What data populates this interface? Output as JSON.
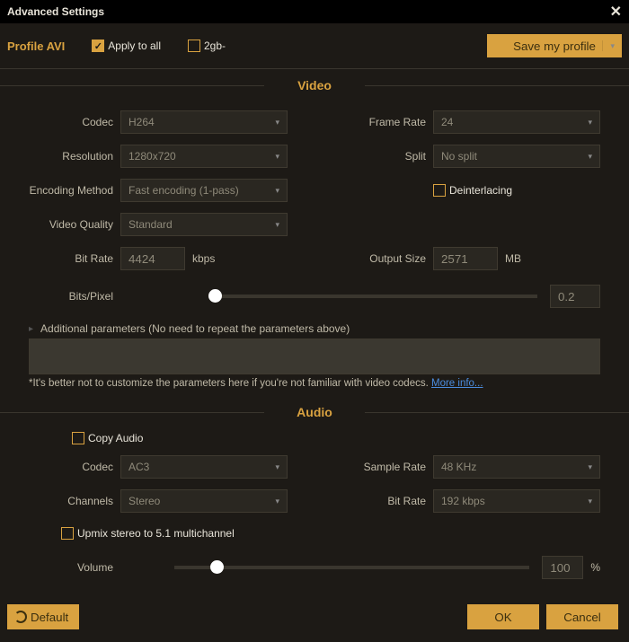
{
  "title": "Advanced Settings",
  "header": {
    "profile_label": "Profile AVI",
    "apply_all_label": "Apply to all",
    "two_gb_label": "2gb-",
    "save_profile_label": "Save my profile"
  },
  "sections": {
    "video": "Video",
    "audio": "Audio"
  },
  "video": {
    "codec_label": "Codec",
    "codec_value": "H264",
    "framerate_label": "Frame Rate",
    "framerate_value": "24",
    "resolution_label": "Resolution",
    "resolution_value": "1280x720",
    "split_label": "Split",
    "split_value": "No split",
    "enc_label": "Encoding Method",
    "enc_value": "Fast encoding (1-pass)",
    "deint_label": "Deinterlacing",
    "vq_label": "Video Quality",
    "vq_value": "Standard",
    "bitrate_label": "Bit Rate",
    "bitrate_value": "4424",
    "bitrate_unit": "kbps",
    "output_label": "Output Size",
    "output_value": "2571",
    "output_unit": "MB",
    "bpp_label": "Bits/Pixel",
    "bpp_value": "0.2",
    "addl_label": "Additional parameters (No need to repeat the parameters above)",
    "hint": "*It's better not to customize the parameters here if you're not familiar with video codecs.",
    "link": "More info..."
  },
  "audio": {
    "copy_label": "Copy Audio",
    "codec_label": "Codec",
    "codec_value": "AC3",
    "sample_label": "Sample Rate",
    "sample_value": "48 KHz",
    "channels_label": "Channels",
    "channels_value": "Stereo",
    "bitrate_label": "Bit Rate",
    "bitrate_value": "192 kbps",
    "upmix_label": "Upmix stereo to 5.1 multichannel",
    "volume_label": "Volume",
    "volume_value": "100",
    "volume_unit": "%"
  },
  "footer": {
    "default": "Default",
    "ok": "OK",
    "cancel": "Cancel"
  }
}
